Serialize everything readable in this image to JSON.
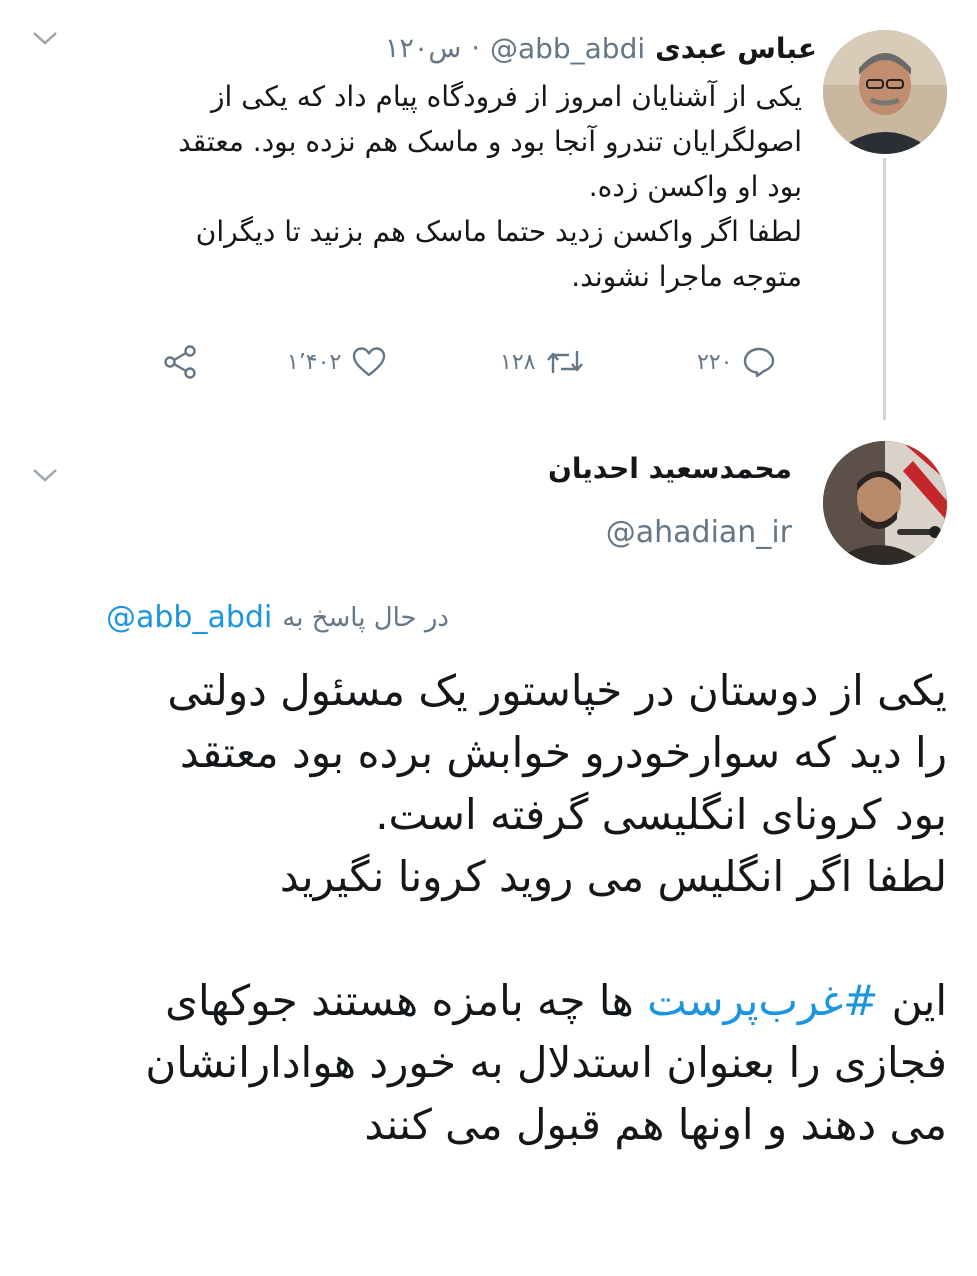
{
  "tweet1": {
    "display_name": "عباس عبدی",
    "handle": "@abb_abdi",
    "time": "۱۲۰س",
    "lines": [
      "یکی از آشنایان امروز از فرودگاه پیام داد که یکی از",
      "اصولگرایان تندرو آنجا بود و ماسک هم نزده بود. معتقد",
      "بود او واکسن زده.",
      "لطفا اگر واکسن زدید حتما ماسک هم بزنید تا دیگران",
      "متوجه ماجرا نشوند."
    ],
    "replies": "۲۲۰",
    "retweets": "۱۲۸",
    "likes": "۱٬۴۰۲"
  },
  "tweet2": {
    "display_name": "محمدسعید احدیان",
    "handle": "@ahadian_ir",
    "reply_prefix": "در حال پاسخ به",
    "reply_to": "@abb_abdi",
    "lines": [
      "یکی از دوستان در خپاستور یک مسئول دولتی",
      "را دید که سوارخودرو خوابش برده بود معتقد",
      "بود کرونای انگلیسی گرفته است.",
      "لطفا اگر انگلیس می روید کرونا نگیرید"
    ],
    "line5_pre": "این",
    "hashtag": "#غرب‌پرست",
    "line5_post": "ها چه بامزه هستند جوکهای",
    "lines_after": [
      "فجازی را بعنوان استدلال به خورد هوادارانشان",
      "می دهند و اونها هم قبول می کنند"
    ]
  },
  "icons": [
    "chevron-down-icon",
    "reply-icon",
    "retweet-icon",
    "like-icon",
    "share-icon"
  ],
  "colors": {
    "link": "#1b95e0",
    "muted": "#657786",
    "thread": "#ccd6dd"
  }
}
